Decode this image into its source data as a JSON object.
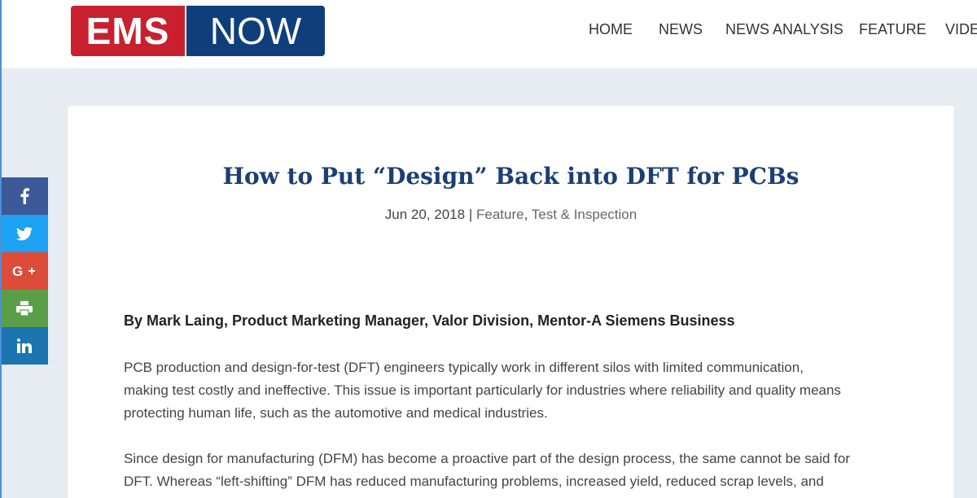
{
  "logo": {
    "left": "EMS",
    "right": "NOW"
  },
  "nav": [
    "HOME",
    "NEWS",
    "NEWS ANALYSIS",
    "FEATURE",
    "VIDE"
  ],
  "article": {
    "title": "How to Put “Design” Back into DFT for PCBs",
    "date": "Jun 20, 2018",
    "sep": "|",
    "cat1": "Feature",
    "comma": ",",
    "cat2": "Test & Inspection",
    "byline": "By Mark Laing, Product Marketing Manager, Valor Division, Mentor-A Siemens Business",
    "p1": [
      "PCB production and design-for-test (DFT) engineers typically work in different silos with limited communication,",
      "making test costly and ineffective. This issue is important particularly for industries where reliability and quality means",
      "protecting human life, such as the automotive and medical industries."
    ],
    "p2": [
      "Since design for manufacturing (DFM) has become a proactive part of the design process, the same cannot be said for",
      "DFT. Whereas “left-shifting” DFM has reduced manufacturing problems, increased yield, reduced scrap levels, and"
    ]
  },
  "social": [
    {
      "icon": "facebook-icon",
      "color": "#3b5998"
    },
    {
      "icon": "twitter-icon",
      "color": "#1da1f2"
    },
    {
      "icon": "google-plus-icon",
      "color": "#dd4b39"
    },
    {
      "icon": "print-icon",
      "color": "#5b9e48"
    },
    {
      "icon": "linkedin-icon",
      "color": "#1b75b0"
    }
  ],
  "colors": {
    "accent": "#1b3f73",
    "logo_red": "#c8202f",
    "logo_blue": "#0f3f7a"
  }
}
